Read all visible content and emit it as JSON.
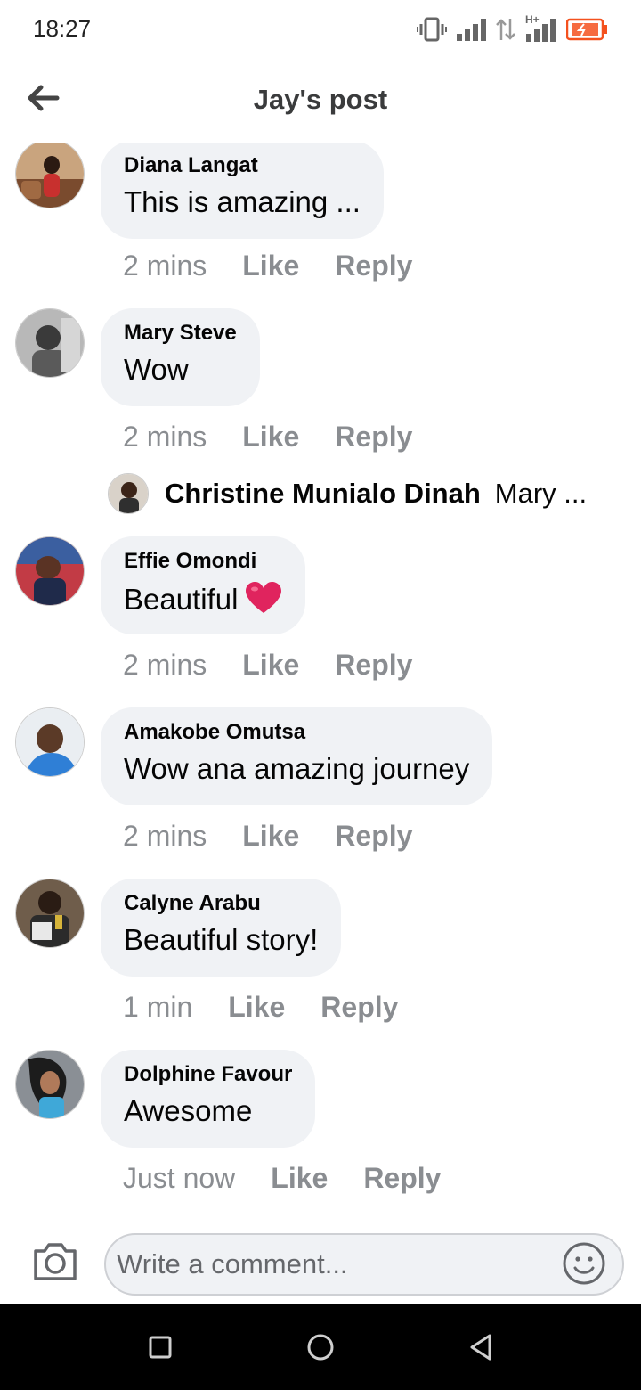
{
  "status_bar": {
    "time": "18:27",
    "icons": [
      "vibrate-icon",
      "signal-icon",
      "data-transfer-icon",
      "hplus-signal-icon",
      "battery-charging-icon"
    ],
    "network_label": "H+"
  },
  "header": {
    "back_icon": "arrow-left-icon",
    "title": "Jay's post"
  },
  "comments": [
    {
      "author": "Diana Langat",
      "text": "This is amazing ...",
      "time": "2 mins",
      "like": "Like",
      "reply": "Reply"
    },
    {
      "author": "Mary Steve",
      "text": "Wow",
      "time": "2 mins",
      "like": "Like",
      "reply": "Reply"
    },
    {
      "author": "Effie Omondi",
      "text": "Beautiful",
      "emoji": "red-heart",
      "time": "2 mins",
      "like": "Like",
      "reply": "Reply"
    },
    {
      "author": "Amakobe Omutsa",
      "text": "Wow ana amazing journey",
      "time": "2 mins",
      "like": "Like",
      "reply": "Reply"
    },
    {
      "author": "Calyne Arabu",
      "text": "Beautiful story!",
      "time": "1 min",
      "like": "Like",
      "reply": "Reply"
    },
    {
      "author": "Dolphine Favour",
      "text": "Awesome",
      "time": "Just now",
      "like": "Like",
      "reply": "Reply"
    }
  ],
  "reply_preview": {
    "author": "Christine Munialo Dinah",
    "text": "Mary ..."
  },
  "composer": {
    "placeholder": "Write a comment...",
    "camera_icon": "camera-icon",
    "emoji_icon": "smiley-icon"
  },
  "nav_bar": {
    "icons": [
      "recents-square-icon",
      "home-circle-icon",
      "back-triangle-icon"
    ]
  },
  "colors": {
    "bubble": "#f0f2f5",
    "meta_text": "#8a8d91",
    "battery": "#f4511e",
    "heart": "#e0245e"
  }
}
